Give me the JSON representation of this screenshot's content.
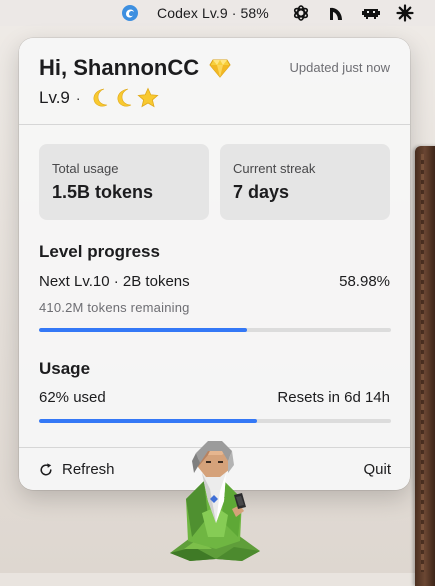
{
  "menubar": {
    "title": "Codex Lv.9 · 58%",
    "icons": [
      "app-swirl-icon",
      "openai-icon",
      "moon-arc-icon",
      "invader-icon",
      "starburst-icon"
    ]
  },
  "popover": {
    "greeting": "Hi, ShannonCC",
    "greeting_icon": "gem-icon",
    "updated": "Updated just now",
    "level": "Lv.9",
    "level_separator": "·",
    "badges": [
      "crescent-moon-icon",
      "crescent-moon-icon",
      "star-icon"
    ],
    "stats": {
      "total_label": "Total usage",
      "total_value": "1.5B tokens",
      "streak_label": "Current streak",
      "streak_value": "7 days"
    },
    "level_progress": {
      "title": "Level progress",
      "next": "Next Lv.10 · 2B tokens",
      "percent_text": "58.98%",
      "remaining": "410.2M tokens remaining",
      "fraction": 0.5898
    },
    "usage": {
      "title": "Usage",
      "used": "62% used",
      "resets": "Resets in 6d 14h",
      "fraction": 0.62
    },
    "footer": {
      "refresh": "Refresh",
      "quit": "Quit"
    }
  },
  "colors": {
    "accent": "#3478f6",
    "track": "#dcdcdc",
    "card": "#e5e5e5"
  }
}
